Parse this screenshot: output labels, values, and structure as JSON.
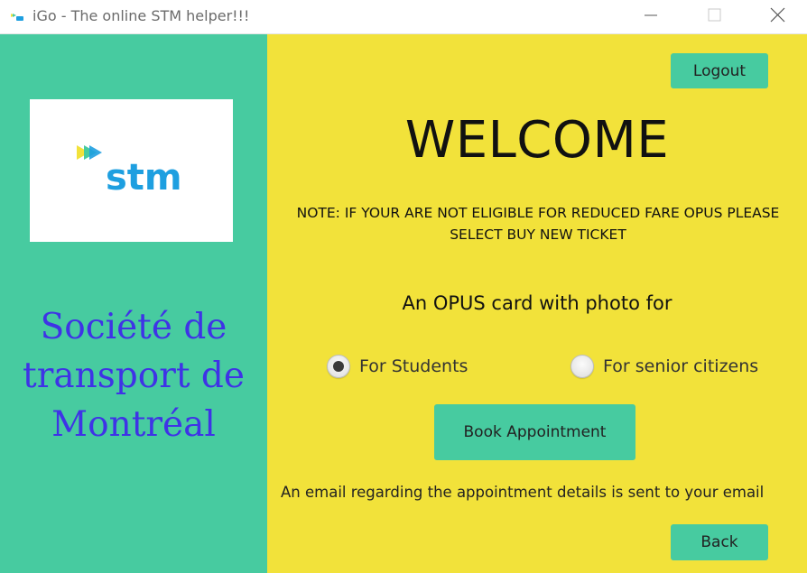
{
  "window": {
    "title": "iGo - The online STM helper!!!",
    "icon": "stm-app-icon",
    "controls": [
      "minimize-icon",
      "maximize-icon",
      "close-icon"
    ]
  },
  "sidebar": {
    "logo": {
      "text": "stm",
      "icon": "stm-logo"
    },
    "org_name": [
      "Société de",
      "transport de",
      "Montréal"
    ]
  },
  "main": {
    "logout_label": "Logout",
    "welcome": "WELCOME",
    "note": "NOTE: IF YOUR ARE NOT ELIGIBLE FOR REDUCED FARE OPUS PLEASE SELECT BUY NEW TICKET",
    "opus_heading": "An OPUS card with photo for",
    "options": [
      {
        "label": "For Students",
        "selected": true
      },
      {
        "label": "For senior citizens",
        "selected": false
      }
    ],
    "book_label": "Book Appointment",
    "email_note": "An email regarding the appointment details is sent to your email",
    "back_label": "Back"
  },
  "colors": {
    "sidebar_bg": "#47cba0",
    "main_bg": "#f2e23a",
    "button_bg": "#47cba0",
    "org_text": "#3f33e6",
    "logo_blue": "#1e9fe0"
  }
}
